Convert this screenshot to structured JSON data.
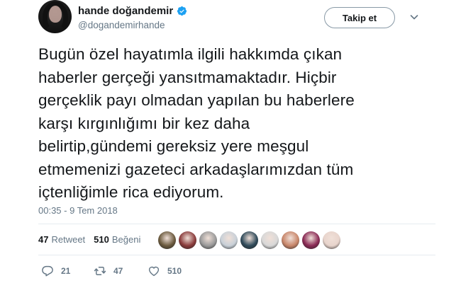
{
  "user": {
    "display_name": "hande doğandemir",
    "handle": "@dogandemirhande",
    "verified": true
  },
  "follow_button": {
    "label": "Takip et"
  },
  "tweet": {
    "text": "Bugün özel hayatımla ilgili hakkımda çıkan\nhaberler gerçeği yansıtmamaktadır. Hiçbir\ngerçeklik payı olmadan yapılan bu haberlere\nkarşı kırgınlığımı bir kez daha\nbelirtip,gündemi gereksiz yere meşgul\netmemenizi gazeteci arkadaşlarımızdan tüm\niçtenliğimle rica ediyorum.",
    "timestamp": "00:35 - 9 Tem 2018"
  },
  "stats": {
    "retweet_count": "47",
    "retweet_label": "Retweet",
    "like_count": "510",
    "like_label": "Beğeni"
  },
  "likers": [
    {
      "name": "liker-avatar-1",
      "color": "#6b5a3e"
    },
    {
      "name": "liker-avatar-2",
      "color": "#8a3b3b"
    },
    {
      "name": "liker-avatar-3",
      "color": "#9a9a9a"
    },
    {
      "name": "liker-avatar-4",
      "color": "#c8d0d8"
    },
    {
      "name": "liker-avatar-5",
      "color": "#2f4a5a"
    },
    {
      "name": "liker-avatar-6",
      "color": "#d8d8d8"
    },
    {
      "name": "liker-avatar-7",
      "color": "#c8866a"
    },
    {
      "name": "liker-avatar-8",
      "color": "#8a2a55"
    },
    {
      "name": "liker-avatar-9",
      "color": "#e8d4cc"
    }
  ],
  "actions": {
    "reply_count": "21",
    "retweet_count": "47",
    "like_count": "510"
  },
  "colors": {
    "verified_blue": "#1da1f2",
    "secondary_text": "#657786",
    "primary_text": "#14171a",
    "divider": "#e6ecf0"
  },
  "icons": [
    "verified-badge-icon",
    "chevron-down-icon",
    "reply-icon",
    "retweet-icon",
    "heart-icon"
  ]
}
